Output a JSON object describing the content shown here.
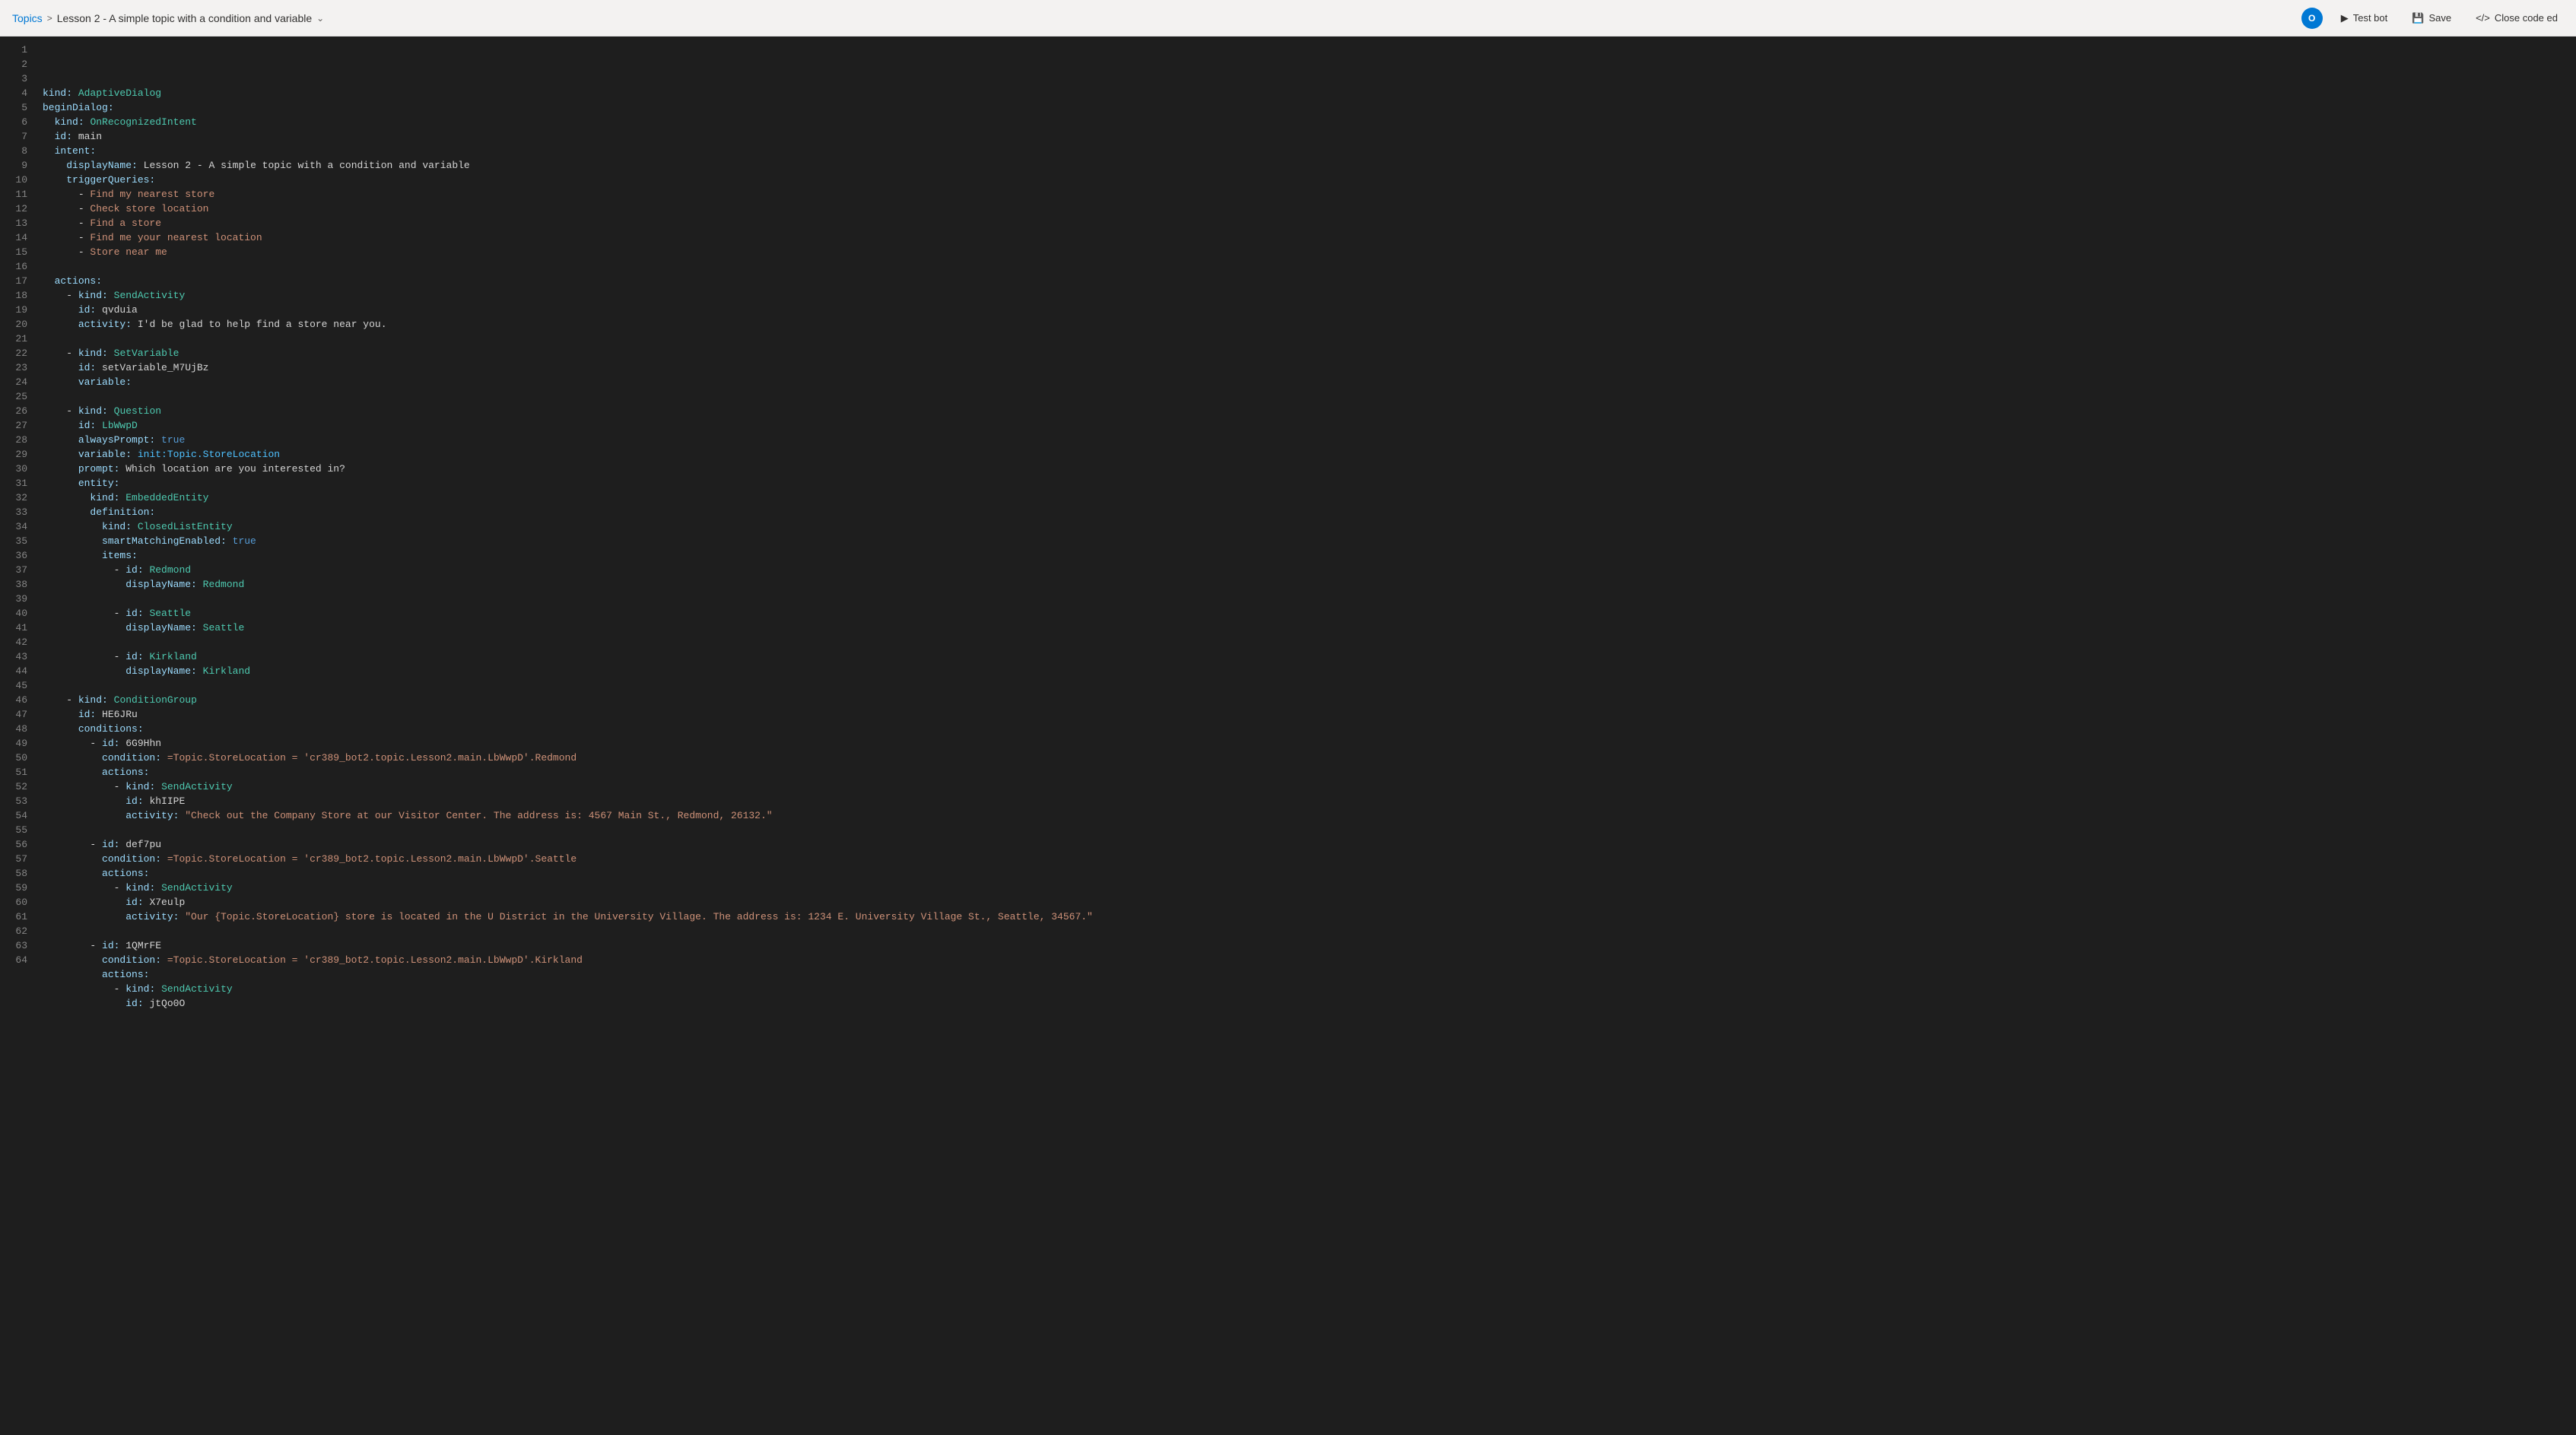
{
  "header": {
    "breadcrumb": {
      "topics_label": "Topics",
      "separator": ">",
      "current_topic": "Lesson 2 - A simple topic with a condition and variable"
    },
    "actions": {
      "test_bot_label": "Test bot",
      "save_label": "Save",
      "close_code_ed_label": "Close code ed"
    },
    "avatar": {
      "initials": "O",
      "bg_color": "#0078d4"
    }
  },
  "editor": {
    "lines": [
      {
        "num": 1,
        "content": "kind: AdaptiveDialog"
      },
      {
        "num": 2,
        "content": "beginDialog:"
      },
      {
        "num": 3,
        "content": "  kind: OnRecognizedIntent"
      },
      {
        "num": 4,
        "content": "  id: main"
      },
      {
        "num": 5,
        "content": "  intent:"
      },
      {
        "num": 6,
        "content": "    displayName: Lesson 2 - A simple topic with a condition and variable"
      },
      {
        "num": 7,
        "content": "    triggerQueries:"
      },
      {
        "num": 8,
        "content": "      - Find my nearest store"
      },
      {
        "num": 9,
        "content": "      - Check store location"
      },
      {
        "num": 10,
        "content": "      - Find a store"
      },
      {
        "num": 11,
        "content": "      - Find me your nearest location"
      },
      {
        "num": 12,
        "content": "      - Store near me"
      },
      {
        "num": 13,
        "content": ""
      },
      {
        "num": 14,
        "content": "  actions:"
      },
      {
        "num": 15,
        "content": "    - kind: SendActivity"
      },
      {
        "num": 16,
        "content": "      id: qvduia"
      },
      {
        "num": 17,
        "content": "      activity: I'd be glad to help find a store near you."
      },
      {
        "num": 18,
        "content": ""
      },
      {
        "num": 19,
        "content": "    - kind: SetVariable"
      },
      {
        "num": 20,
        "content": "      id: setVariable_M7UjBz"
      },
      {
        "num": 21,
        "content": "      variable:"
      },
      {
        "num": 22,
        "content": ""
      },
      {
        "num": 23,
        "content": "    - kind: Question"
      },
      {
        "num": 24,
        "content": "      id: LbWwpD"
      },
      {
        "num": 25,
        "content": "      alwaysPrompt: true"
      },
      {
        "num": 26,
        "content": "      variable: init:Topic.StoreLocation"
      },
      {
        "num": 27,
        "content": "      prompt: Which location are you interested in?"
      },
      {
        "num": 28,
        "content": "      entity:"
      },
      {
        "num": 29,
        "content": "        kind: EmbeddedEntity"
      },
      {
        "num": 30,
        "content": "        definition:"
      },
      {
        "num": 31,
        "content": "          kind: ClosedListEntity"
      },
      {
        "num": 32,
        "content": "          smartMatchingEnabled: true"
      },
      {
        "num": 33,
        "content": "          items:"
      },
      {
        "num": 34,
        "content": "            - id: Redmond"
      },
      {
        "num": 35,
        "content": "              displayName: Redmond"
      },
      {
        "num": 36,
        "content": ""
      },
      {
        "num": 37,
        "content": "            - id: Seattle"
      },
      {
        "num": 38,
        "content": "              displayName: Seattle"
      },
      {
        "num": 39,
        "content": ""
      },
      {
        "num": 40,
        "content": "            - id: Kirkland"
      },
      {
        "num": 41,
        "content": "              displayName: Kirkland"
      },
      {
        "num": 42,
        "content": ""
      },
      {
        "num": 43,
        "content": "    - kind: ConditionGroup"
      },
      {
        "num": 44,
        "content": "      id: HE6JRu"
      },
      {
        "num": 45,
        "content": "      conditions:"
      },
      {
        "num": 46,
        "content": "        - id: 6G9Hhn"
      },
      {
        "num": 47,
        "content": "          condition: =Topic.StoreLocation = 'cr389_bot2.topic.Lesson2.main.LbWwpD'.Redmond"
      },
      {
        "num": 48,
        "content": "          actions:"
      },
      {
        "num": 49,
        "content": "            - kind: SendActivity"
      },
      {
        "num": 50,
        "content": "              id: khIIPE"
      },
      {
        "num": 51,
        "content": "              activity: \"Check out the Company Store at our Visitor Center. The address is: 4567 Main St., Redmond, 26132.\""
      },
      {
        "num": 52,
        "content": ""
      },
      {
        "num": 53,
        "content": "        - id: def7pu"
      },
      {
        "num": 54,
        "content": "          condition: =Topic.StoreLocation = 'cr389_bot2.topic.Lesson2.main.LbWwpD'.Seattle"
      },
      {
        "num": 55,
        "content": "          actions:"
      },
      {
        "num": 56,
        "content": "            - kind: SendActivity"
      },
      {
        "num": 57,
        "content": "              id: X7eulp"
      },
      {
        "num": 58,
        "content": "              activity: \"Our {Topic.StoreLocation} store is located in the U District in the University Village. The address is: 1234 E. University Village St., Seattle, 34567.\""
      },
      {
        "num": 59,
        "content": ""
      },
      {
        "num": 60,
        "content": "        - id: 1QMrFE"
      },
      {
        "num": 61,
        "content": "          condition: =Topic.StoreLocation = 'cr389_bot2.topic.Lesson2.main.LbWwpD'.Kirkland"
      },
      {
        "num": 62,
        "content": "          actions:"
      },
      {
        "num": 63,
        "content": "            - kind: SendActivity"
      },
      {
        "num": 64,
        "content": "              id: jtQo0O"
      }
    ]
  }
}
